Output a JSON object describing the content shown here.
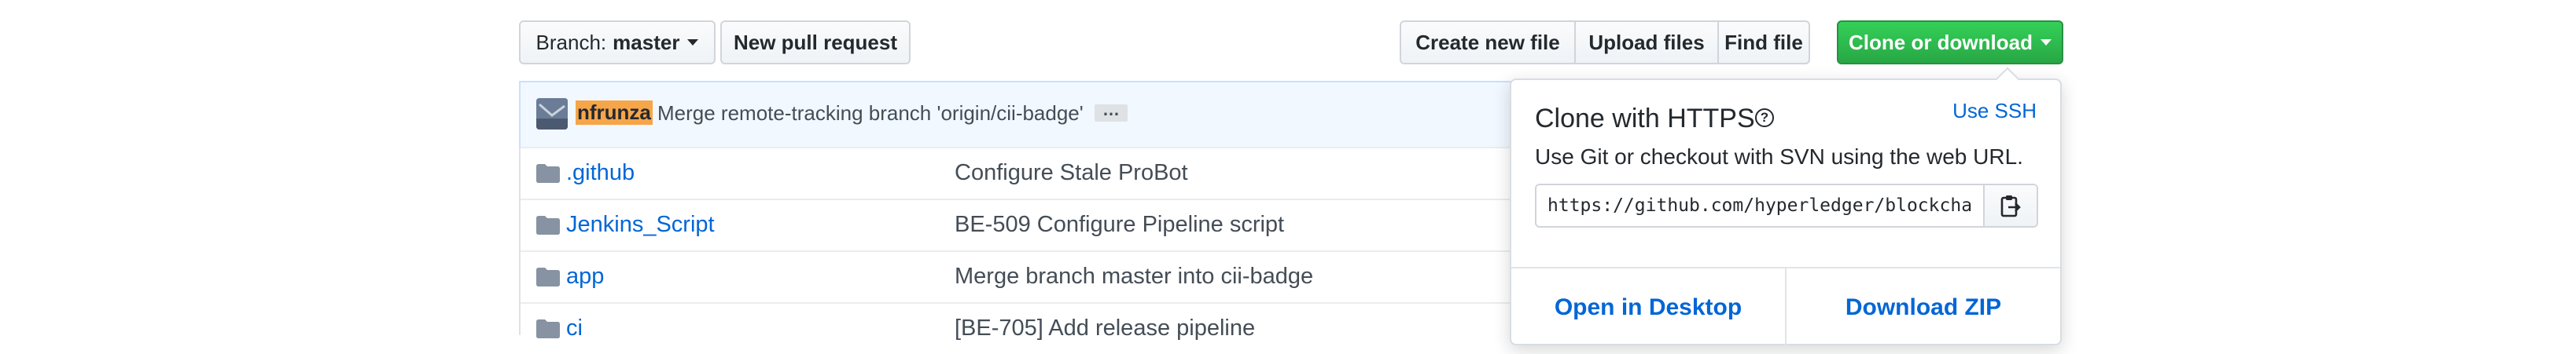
{
  "toolbar": {
    "branch_prefix": "Branch:",
    "branch_name": "master",
    "new_pull_request": "New pull request",
    "create_new_file": "Create new file",
    "upload_files": "Upload files",
    "find_file": "Find file",
    "clone_or_download": "Clone or download"
  },
  "commit": {
    "author": "nfrunza",
    "message": "Merge remote-tracking branch 'origin/cii-badge'",
    "ellipsis": "…"
  },
  "files": [
    {
      "name": ".github",
      "message": "Configure Stale ProBot"
    },
    {
      "name": "Jenkins_Script",
      "message": "BE-509 Configure Pipeline script"
    },
    {
      "name": "app",
      "message": "Merge branch master into cii-badge"
    },
    {
      "name": "ci",
      "message": "[BE-705] Add release pipeline"
    }
  ],
  "clone_popover": {
    "title": "Clone with HTTPS",
    "help_icon": "question-circle-icon",
    "use_ssh": "Use SSH",
    "description": "Use Git or checkout with SVN using the web URL.",
    "url": "https://github.com/hyperledger/blockchain-explorer.git",
    "copy_icon": "clipboard-icon",
    "open_in_desktop": "Open in Desktop",
    "download_zip": "Download ZIP"
  },
  "colors": {
    "clone_button_green": "#2ea44f",
    "link_blue": "#0366d6",
    "author_highlight": "#f6a549",
    "commit_bar_bg": "#f1f8ff"
  }
}
